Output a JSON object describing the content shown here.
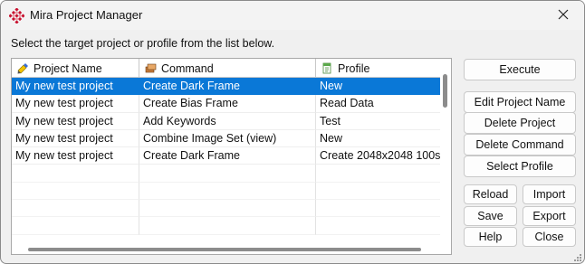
{
  "window": {
    "title": "Mira Project Manager",
    "app_icon": "mira-logo-icon",
    "close_icon": "close-icon"
  },
  "instruction": "Select the target project or profile from the list below.",
  "table": {
    "columns": [
      {
        "label": "Project Name",
        "icon": "project-icon"
      },
      {
        "label": "Command",
        "icon": "command-icon"
      },
      {
        "label": "Profile",
        "icon": "profile-icon"
      }
    ],
    "rows": [
      {
        "project": "My new test project",
        "command": "Create Dark Frame",
        "profile": "New",
        "selected": true
      },
      {
        "project": "My new test project",
        "command": "Create Bias Frame",
        "profile": "Read Data",
        "selected": false
      },
      {
        "project": "My new test project",
        "command": "Add Keywords",
        "profile": "Test",
        "selected": false
      },
      {
        "project": "My new test project",
        "command": "Combine Image Set (view)",
        "profile": "New",
        "selected": false
      },
      {
        "project": "My new test project",
        "command": "Create Dark Frame",
        "profile": "Create 2048x2048 100s",
        "selected": false
      }
    ],
    "selection_color": "#0a78d7"
  },
  "buttons": {
    "execute": "Execute",
    "edit_project_name": "Edit Project Name",
    "delete_project": "Delete Project",
    "delete_command": "Delete Command",
    "select_profile": "Select Profile",
    "reload": "Reload",
    "import": "Import",
    "save": "Save",
    "export": "Export",
    "help": "Help",
    "close": "Close"
  }
}
